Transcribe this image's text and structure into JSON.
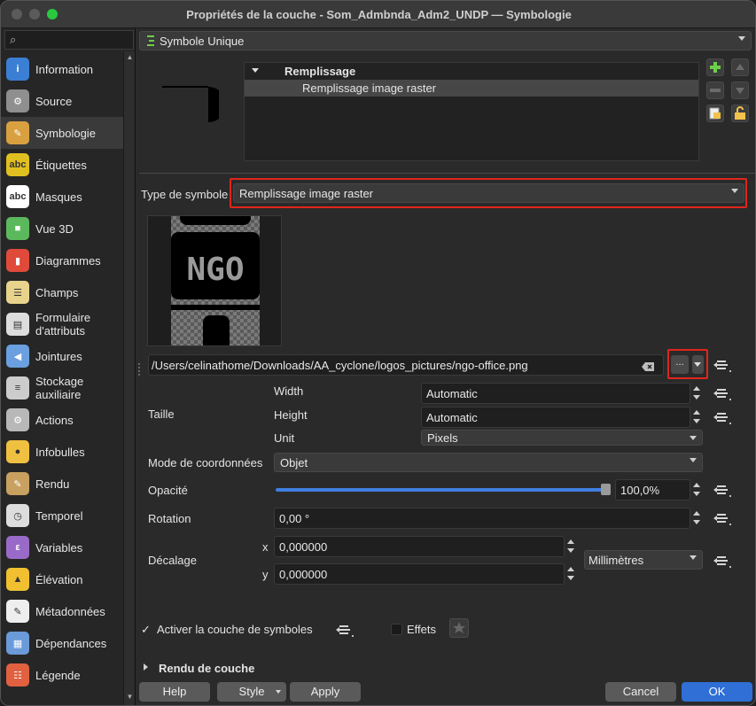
{
  "window": {
    "title": "Propriétés de la couche - Som_Admbnda_Adm2_UNDP — Symbologie"
  },
  "sidebar": {
    "items": [
      {
        "label": "Information",
        "icon": "info-icon",
        "color": "#3b7fd4"
      },
      {
        "label": "Source",
        "icon": "wrench-icon",
        "color": "#8f8f8f"
      },
      {
        "label": "Symbologie",
        "icon": "paintbrush-icon",
        "color": "#d9a040"
      },
      {
        "label": "Étiquettes",
        "icon": "abc-label-icon",
        "color": "#e0c020"
      },
      {
        "label": "Masques",
        "icon": "abc-mask-icon",
        "color": "#ffffff"
      },
      {
        "label": "Vue 3D",
        "icon": "cube-icon",
        "color": "#5cb85c"
      },
      {
        "label": "Diagrammes",
        "icon": "diagram-icon",
        "color": "#e04a3a"
      },
      {
        "label": "Champs",
        "icon": "fields-icon",
        "color": "#e8d38c"
      },
      {
        "label": "Formulaire d'attributs",
        "icon": "form-icon",
        "color": "#dddddd"
      },
      {
        "label": "Jointures",
        "icon": "join-icon",
        "color": "#6aa0e0"
      },
      {
        "label": "Stockage auxiliaire",
        "icon": "database-icon",
        "color": "#cccccc"
      },
      {
        "label": "Actions",
        "icon": "actions-gear-icon",
        "color": "#b8b8b8"
      },
      {
        "label": "Infobulles",
        "icon": "tooltip-bubble-icon",
        "color": "#f0c040"
      },
      {
        "label": "Rendu",
        "icon": "render-brush-icon",
        "color": "#c8a060"
      },
      {
        "label": "Temporel",
        "icon": "clock-icon",
        "color": "#dddddd"
      },
      {
        "label": "Variables",
        "icon": "variables-icon",
        "color": "#9a6ac8"
      },
      {
        "label": "Élévation",
        "icon": "elevation-icon",
        "color": "#f0c030"
      },
      {
        "label": "Métadonnées",
        "icon": "metadata-icon",
        "color": "#eeeeee"
      },
      {
        "label": "Dépendances",
        "icon": "dependencies-icon",
        "color": "#6a9ad8"
      },
      {
        "label": "Légende",
        "icon": "legend-icon",
        "color": "#e06040"
      }
    ],
    "selected_index": 2
  },
  "renderer": {
    "value": "Symbole Unique"
  },
  "layers_tree": {
    "root": "Remplissage",
    "child": "Remplissage image raster"
  },
  "symbol_type": {
    "label": "Type de symbole",
    "value": "Remplissage image raster"
  },
  "preview": {
    "text": "NGO"
  },
  "file": {
    "path": "/Users/celinathome/Downloads/AA_cyclone/logos_pictures/ngo-office.png",
    "browse_label": "..."
  },
  "size": {
    "group_label": "Taille",
    "width_label": "Width",
    "width_value": "Automatic",
    "height_label": "Height",
    "height_value": "Automatic",
    "unit_label": "Unit",
    "unit_value": "Pixels"
  },
  "coords": {
    "label": "Mode de coordonnées",
    "value": "Objet"
  },
  "opacity": {
    "label": "Opacité",
    "value": "100,0%",
    "level": 1.0
  },
  "rotation": {
    "label": "Rotation",
    "value": "0,00 °"
  },
  "offset": {
    "label": "Décalage",
    "x_label": "x",
    "x_value": "0,000000",
    "y_label": "y",
    "y_value": "0,000000",
    "unit_value": "Millimètres"
  },
  "enable": {
    "label": "Activer la couche de symboles",
    "checked": true
  },
  "effects": {
    "label": "Effets",
    "checked": false
  },
  "layer_rendering": {
    "label": "Rendu de couche"
  },
  "buttons": {
    "help": "Help",
    "style": "Style",
    "apply": "Apply",
    "cancel": "Cancel",
    "ok": "OK"
  }
}
